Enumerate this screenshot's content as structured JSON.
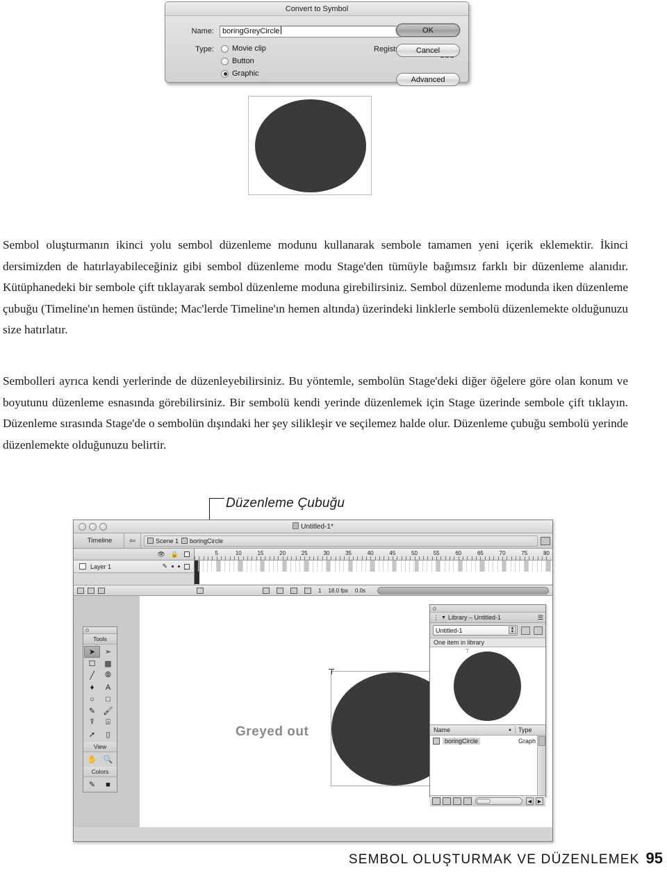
{
  "dialog": {
    "title": "Convert to Symbol",
    "name_label": "Name:",
    "name_value": "boringGreyCircle",
    "type_label": "Type:",
    "types": [
      {
        "label": "Movie clip",
        "selected": false
      },
      {
        "label": "Button",
        "selected": false
      },
      {
        "label": "Graphic",
        "selected": true
      }
    ],
    "registration_label": "Registration:",
    "buttons": {
      "ok": "OK",
      "cancel": "Cancel",
      "advanced": "Advanced"
    }
  },
  "body": {
    "paragraph1": "Sembol oluşturmanın ikinci yolu sembol düzenleme modunu kullanarak sembole tamamen yeni içerik eklemektir. İkinci dersimizden de hatırlayabileceğiniz gibi sembol düzenleme modu Stage'den tümüyle bağımsız farklı bir düzenleme alanıdır. Kütüphanedeki bir sembole çift tıklayarak sembol düzenleme moduna girebilirsiniz. Sembol düzenleme modunda iken düzenleme çubuğu (Timeline'ın hemen üstünde; Mac'lerde Timeline'ın hemen altında) üzerindeki linklerle sembolü düzenlemekte olduğunuzu size hatırlatır.",
    "paragraph2": "Sembolleri ayrıca kendi yerlerinde de düzenleyebilirsiniz. Bu yöntemle, sembolün Stage'deki diğer öğelere göre olan konum ve boyutunu düzenleme esnasında görebilirsiniz. Bir sembolü kendi yerinde düzenlemek için Stage üzerinde sembole çift tıklayın. Düzenleme sırasında Stage'de o sembolün dışındaki her şey silikleşir ve seçilemez halde olur. Düzenleme çubuğu sembolü yerinde düzenlemekte olduğunuzu belirtir."
  },
  "annotation": {
    "label": "Düzenleme Çubuğu"
  },
  "flash": {
    "window_title": "Untitled-1*",
    "timeline_tab": "Timeline",
    "breadcrumbs": [
      {
        "label": "Scene 1"
      },
      {
        "label": "boringCircle"
      }
    ],
    "timeline": {
      "ruler_ticks": [
        5,
        10,
        15,
        20,
        25,
        30,
        35,
        40,
        45,
        50,
        55,
        60,
        65,
        70,
        75,
        80
      ],
      "layer_name": "Layer 1",
      "status": {
        "current_frame": "1",
        "fps": "18.0 fps",
        "elapsed": "0.0s"
      }
    },
    "tools": {
      "title": "Tools",
      "view_title": "View",
      "colors_title": "Colors",
      "items": [
        "arrow-tool",
        "subselect-tool",
        "free-transform-tool",
        "fill-transform-tool",
        "line-tool",
        "lasso-tool",
        "pen-tool",
        "text-tool",
        "oval-tool",
        "rectangle-tool",
        "pencil-tool",
        "brush-tool",
        "ink-bottle-tool",
        "paint-bucket-tool",
        "eyedropper-tool",
        "eraser-tool"
      ],
      "view_items": [
        "hand-tool",
        "zoom-tool"
      ]
    },
    "stage": {
      "greyed_label": "Greyed out"
    },
    "library": {
      "panel_title": "Library – Untitled-1",
      "document_select": "Untitled-1",
      "item_count": "One item in library",
      "columns": [
        "Name",
        "Type"
      ],
      "rows": [
        {
          "name": "boringCircle",
          "type": "Graph"
        }
      ]
    }
  },
  "footer": {
    "text": "SEMBOL OLUŞTURMAK VE DÜZENLEMEK",
    "page": "95"
  },
  "colors": {
    "circle_fill": "#3a3a3a",
    "greyed_text": "#8a8a8a"
  }
}
